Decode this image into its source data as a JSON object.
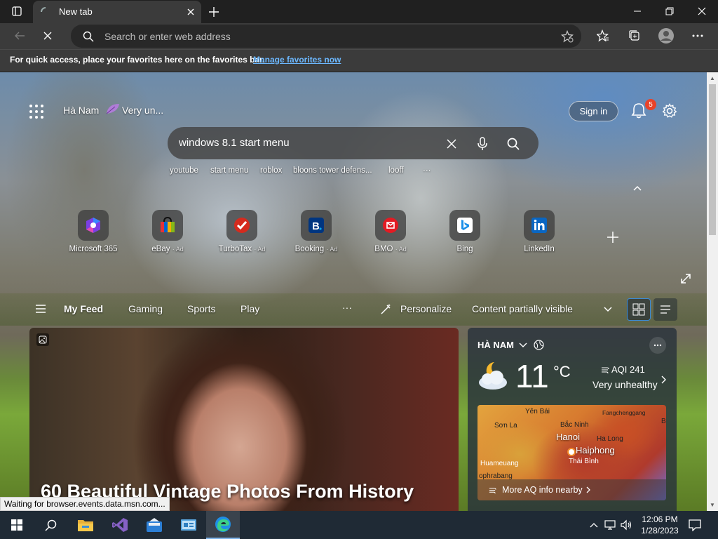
{
  "browser": {
    "tab": {
      "title": "New tab"
    },
    "address": {
      "placeholder": "Search or enter web address"
    },
    "favbar": {
      "message": "For quick access, place your favorites here on the favorites bar.",
      "link": "Manage favorites now"
    }
  },
  "ntp": {
    "location": "Hà Nam",
    "air_quality_short": "Very un...",
    "signin_label": "Sign in",
    "notification_count": "5",
    "search_query": "windows 8.1 start menu",
    "suggestions": [
      "youtube",
      "start menu",
      "roblox",
      "bloons tower defens...",
      "looff",
      "···"
    ],
    "quick_links": [
      {
        "name": "Microsoft 365",
        "ad": ""
      },
      {
        "name": "eBay",
        "ad": "· Ad"
      },
      {
        "name": "TurboTax",
        "ad": "· Ad"
      },
      {
        "name": "Booking",
        "ad": "· Ad"
      },
      {
        "name": "BMO",
        "ad": "· Ad"
      },
      {
        "name": "Bing",
        "ad": ""
      },
      {
        "name": "LinkedIn",
        "ad": ""
      }
    ],
    "feed_tabs": [
      "My Feed",
      "Gaming",
      "Sports",
      "Play"
    ],
    "feed_more": "···",
    "personalize_label": "Personalize",
    "content_visibility": "Content partially visible",
    "main_card_title": "60 Beautiful Vintage Photos From History",
    "weather": {
      "location": "HÀ NAM",
      "temperature": "11",
      "unit": "°C",
      "aqi": "AQI 241",
      "aqi_status": "Very unhealthy",
      "more_aq": "More AQ info nearby",
      "map_labels": [
        "Yên Bái",
        "Fangchenggang",
        "Sơn La",
        "Bắc Ninh",
        "Hanoi",
        "Ha Long",
        "Haiphong",
        "Thái Bình",
        "Huameuang",
        "ophrabang",
        "B"
      ]
    }
  },
  "status_tip": "Waiting for browser.events.data.msn.com...",
  "taskbar": {
    "time": "12:06 PM",
    "date": "1/28/2023"
  }
}
